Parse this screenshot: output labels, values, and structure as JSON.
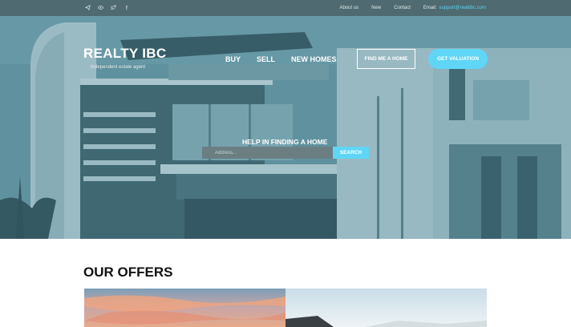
{
  "topbar": {
    "social_icons": [
      "telegram-icon",
      "eye-icon",
      "twitter-icon",
      "facebook-icon"
    ],
    "links": [
      {
        "label": "About us"
      },
      {
        "label": "New"
      },
      {
        "label": "Contact"
      }
    ],
    "email_label": "Email:",
    "email_value": "support@realtibc.com"
  },
  "brand": {
    "title": "REALTY IBC",
    "tagline": "Independent estate agent"
  },
  "nav": {
    "items": [
      {
        "label": "BUY"
      },
      {
        "label": "SELL"
      },
      {
        "label": "NEW HOMES"
      }
    ],
    "find_button": "FIND ME A HOME",
    "valuation_button": "GET VALUATION"
  },
  "search": {
    "heading": "HELP IN FINDING A HOME",
    "placeholder": "Address...",
    "button": "SEARCH"
  },
  "offers": {
    "title": "OUR OFFERS"
  },
  "colors": {
    "accent": "#5fd6f6",
    "topbar": "#4f6a70",
    "hero_tint": "#5f8a96"
  }
}
